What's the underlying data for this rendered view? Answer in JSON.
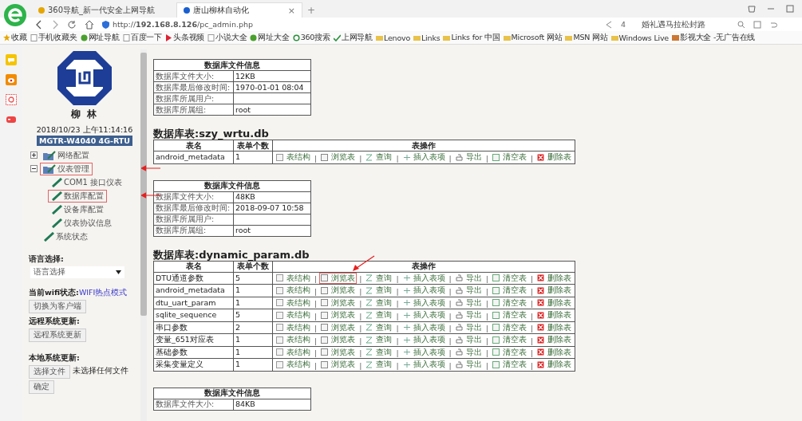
{
  "browser": {
    "tabs": [
      {
        "title": "360导航_新一代安全上网导航",
        "selected": false
      },
      {
        "title": "唐山柳林自动化",
        "selected": true
      }
    ],
    "tab_close": "×",
    "new_tab": "+",
    "url": "http://**192.168.8.126**/pc_admin.php",
    "share_count": "4",
    "search_value": "婚礼遇马拉松封路",
    "bookmarks": [
      {
        "label": "收藏",
        "kind": "star"
      },
      {
        "label": "手机收藏夹",
        "kind": "page"
      },
      {
        "label": "网址导航",
        "kind": "globe"
      },
      {
        "label": "百度一下",
        "kind": "page"
      },
      {
        "label": "头条视频",
        "kind": "play"
      },
      {
        "label": "小说大全",
        "kind": "page"
      },
      {
        "label": "网址大全",
        "kind": "globe"
      },
      {
        "label": "360搜索",
        "kind": "ring"
      },
      {
        "label": "上网导航",
        "kind": "check"
      },
      {
        "label": "Lenovo",
        "kind": "folder"
      },
      {
        "label": "Links",
        "kind": "folder"
      },
      {
        "label": "Links for 中国",
        "kind": "folder"
      },
      {
        "label": "Microsoft 网站",
        "kind": "folder"
      },
      {
        "label": "MSN 网站",
        "kind": "folder"
      },
      {
        "label": "Windows Live",
        "kind": "folder"
      },
      {
        "label": "影视大全 -无广告在线",
        "kind": "film"
      }
    ]
  },
  "sidebar": {
    "brand": "柳 林",
    "datetime": "2018/10/23 上午11:14:16",
    "device": "MGTR-W4040 4G-RTU",
    "tree": [
      {
        "label": "网络配置",
        "kind": "folder",
        "expanded": false,
        "highlighted": false
      },
      {
        "label": "仪表管理",
        "kind": "folder",
        "expanded": true,
        "highlighted": true,
        "children": [
          {
            "label": "COM1 接口仪表",
            "kind": "leaf",
            "highlighted": false
          },
          {
            "label": "数据库配置",
            "kind": "leaf",
            "highlighted": true
          },
          {
            "label": "设备库配置",
            "kind": "leaf",
            "highlighted": false
          },
          {
            "label": "仪表协议信息",
            "kind": "leaf",
            "highlighted": false
          }
        ]
      },
      {
        "label": "系统状态",
        "kind": "leaf",
        "highlighted": false
      }
    ],
    "language": {
      "label": "语言选择:",
      "value": "语言选择"
    },
    "wifi": {
      "label": "当前wifi状态:",
      "value": "WIFI热点模式",
      "button": "切换为客户端"
    },
    "remote": {
      "label": "远程系统更新:",
      "button": "远程系统更新"
    },
    "local": {
      "label": "本地系统更新:",
      "file_button": "选择文件",
      "file_status": "未选择任何文件",
      "confirm": "确定"
    }
  },
  "content": [
    {
      "kind": "info",
      "title": "数据库文件信息",
      "rows": [
        [
          "数据库文件大小:",
          "12KB"
        ],
        [
          "数据库最后修改时间:",
          "1970-01-01 08:04"
        ],
        [
          "数据库所属用户:",
          ""
        ],
        [
          "数据库所属组:",
          "root"
        ]
      ]
    },
    {
      "kind": "tables",
      "heading": "数据库表:szy_wrtu.db",
      "columns": [
        "表名",
        "表单个数",
        "表操作"
      ],
      "rows": [
        {
          "name": "android_metadata",
          "count": "1",
          "ops": [
            {
              "label": "表结构",
              "kind": "structure"
            },
            {
              "label": "|",
              "kind": "separator"
            },
            {
              "label": "浏览表",
              "kind": "browse",
              "marked": false
            },
            {
              "label": "|",
              "kind": "separator"
            },
            {
              "label": "查询",
              "kind": "query"
            },
            {
              "label": "|",
              "kind": "separator"
            },
            {
              "label": "插入表项",
              "kind": "insert"
            },
            {
              "label": "|",
              "kind": "separator"
            },
            {
              "label": "导出",
              "kind": "export"
            },
            {
              "label": "|",
              "kind": "separator"
            },
            {
              "label": "清空表",
              "kind": "empty"
            },
            {
              "label": "|",
              "kind": "separator"
            },
            {
              "label": "删除表",
              "kind": "delete"
            }
          ]
        }
      ]
    },
    {
      "kind": "info",
      "title": "数据库文件信息",
      "rows": [
        [
          "数据库文件大小:",
          "48KB"
        ],
        [
          "数据库最后修改时间:",
          "2018-09-07 10:58"
        ],
        [
          "数据库所属用户:",
          ""
        ],
        [
          "数据库所属组:",
          "root"
        ]
      ]
    },
    {
      "kind": "tables",
      "heading": "数据库表:dynamic_param.db",
      "columns": [
        "表名",
        "表单个数",
        "表操作"
      ],
      "rows": [
        {
          "name": "DTU通道参数",
          "count": "5",
          "ops": [
            {
              "label": "表结构",
              "kind": "structure"
            },
            {
              "label": "|",
              "kind": "separator"
            },
            {
              "label": "浏览表",
              "kind": "browse",
              "marked": true
            },
            {
              "label": "|",
              "kind": "separator"
            },
            {
              "label": "查询",
              "kind": "query"
            },
            {
              "label": "|",
              "kind": "separator"
            },
            {
              "label": "插入表项",
              "kind": "insert"
            },
            {
              "label": "|",
              "kind": "separator"
            },
            {
              "label": "导出",
              "kind": "export"
            },
            {
              "label": "|",
              "kind": "separator"
            },
            {
              "label": "清空表",
              "kind": "empty"
            },
            {
              "label": "|",
              "kind": "separator"
            },
            {
              "label": "删除表",
              "kind": "delete"
            }
          ]
        },
        {
          "name": "android_metadata",
          "count": "1",
          "ops": [
            {
              "label": "表结构",
              "kind": "structure"
            },
            {
              "label": "|",
              "kind": "separator"
            },
            {
              "label": "浏览表",
              "kind": "browse",
              "marked": false
            },
            {
              "label": "|",
              "kind": "separator"
            },
            {
              "label": "查询",
              "kind": "query"
            },
            {
              "label": "|",
              "kind": "separator"
            },
            {
              "label": "插入表项",
              "kind": "insert"
            },
            {
              "label": "|",
              "kind": "separator"
            },
            {
              "label": "导出",
              "kind": "export"
            },
            {
              "label": "|",
              "kind": "separator"
            },
            {
              "label": "清空表",
              "kind": "empty"
            },
            {
              "label": "|",
              "kind": "separator"
            },
            {
              "label": "删除表",
              "kind": "delete"
            }
          ]
        },
        {
          "name": "dtu_uart_param",
          "count": "1",
          "ops": [
            {
              "label": "表结构",
              "kind": "structure"
            },
            {
              "label": "|",
              "kind": "separator"
            },
            {
              "label": "浏览表",
              "kind": "browse",
              "marked": false
            },
            {
              "label": "|",
              "kind": "separator"
            },
            {
              "label": "查询",
              "kind": "query"
            },
            {
              "label": "|",
              "kind": "separator"
            },
            {
              "label": "插入表项",
              "kind": "insert"
            },
            {
              "label": "|",
              "kind": "separator"
            },
            {
              "label": "导出",
              "kind": "export"
            },
            {
              "label": "|",
              "kind": "separator"
            },
            {
              "label": "清空表",
              "kind": "empty"
            },
            {
              "label": "|",
              "kind": "separator"
            },
            {
              "label": "删除表",
              "kind": "delete"
            }
          ]
        },
        {
          "name": "sqlite_sequence",
          "count": "5",
          "ops": [
            {
              "label": "表结构",
              "kind": "structure"
            },
            {
              "label": "|",
              "kind": "separator"
            },
            {
              "label": "浏览表",
              "kind": "browse",
              "marked": false
            },
            {
              "label": "|",
              "kind": "separator"
            },
            {
              "label": "查询",
              "kind": "query"
            },
            {
              "label": "|",
              "kind": "separator"
            },
            {
              "label": "插入表项",
              "kind": "insert"
            },
            {
              "label": "|",
              "kind": "separator"
            },
            {
              "label": "导出",
              "kind": "export"
            },
            {
              "label": "|",
              "kind": "separator"
            },
            {
              "label": "清空表",
              "kind": "empty"
            },
            {
              "label": "|",
              "kind": "separator"
            },
            {
              "label": "删除表",
              "kind": "delete"
            }
          ]
        },
        {
          "name": "串口参数",
          "count": "2",
          "ops": [
            {
              "label": "表结构",
              "kind": "structure"
            },
            {
              "label": "|",
              "kind": "separator"
            },
            {
              "label": "浏览表",
              "kind": "browse",
              "marked": false
            },
            {
              "label": "|",
              "kind": "separator"
            },
            {
              "label": "查询",
              "kind": "query"
            },
            {
              "label": "|",
              "kind": "separator"
            },
            {
              "label": "插入表项",
              "kind": "insert"
            },
            {
              "label": "|",
              "kind": "separator"
            },
            {
              "label": "导出",
              "kind": "export"
            },
            {
              "label": "|",
              "kind": "separator"
            },
            {
              "label": "清空表",
              "kind": "empty"
            },
            {
              "label": "|",
              "kind": "separator"
            },
            {
              "label": "删除表",
              "kind": "delete"
            }
          ]
        },
        {
          "name": "变量_651对应表",
          "count": "1",
          "ops": [
            {
              "label": "表结构",
              "kind": "structure"
            },
            {
              "label": "|",
              "kind": "separator"
            },
            {
              "label": "浏览表",
              "kind": "browse",
              "marked": false
            },
            {
              "label": "|",
              "kind": "separator"
            },
            {
              "label": "查询",
              "kind": "query"
            },
            {
              "label": "|",
              "kind": "separator"
            },
            {
              "label": "插入表项",
              "kind": "insert"
            },
            {
              "label": "|",
              "kind": "separator"
            },
            {
              "label": "导出",
              "kind": "export"
            },
            {
              "label": "|",
              "kind": "separator"
            },
            {
              "label": "清空表",
              "kind": "empty"
            },
            {
              "label": "|",
              "kind": "separator"
            },
            {
              "label": "删除表",
              "kind": "delete"
            }
          ]
        },
        {
          "name": "基础参数",
          "count": "1",
          "ops": [
            {
              "label": "表结构",
              "kind": "structure"
            },
            {
              "label": "|",
              "kind": "separator"
            },
            {
              "label": "浏览表",
              "kind": "browse",
              "marked": false
            },
            {
              "label": "|",
              "kind": "separator"
            },
            {
              "label": "查询",
              "kind": "query"
            },
            {
              "label": "|",
              "kind": "separator"
            },
            {
              "label": "插入表项",
              "kind": "insert"
            },
            {
              "label": "|",
              "kind": "separator"
            },
            {
              "label": "导出",
              "kind": "export"
            },
            {
              "label": "|",
              "kind": "separator"
            },
            {
              "label": "清空表",
              "kind": "empty"
            },
            {
              "label": "|",
              "kind": "separator"
            },
            {
              "label": "删除表",
              "kind": "delete"
            }
          ]
        },
        {
          "name": "采集变量定义",
          "count": "1",
          "ops": [
            {
              "label": "表结构",
              "kind": "structure"
            },
            {
              "label": "|",
              "kind": "separator"
            },
            {
              "label": "浏览表",
              "kind": "browse",
              "marked": false
            },
            {
              "label": "|",
              "kind": "separator"
            },
            {
              "label": "查询",
              "kind": "query"
            },
            {
              "label": "|",
              "kind": "separator"
            },
            {
              "label": "插入表项",
              "kind": "insert"
            },
            {
              "label": "|",
              "kind": "separator"
            },
            {
              "label": "导出",
              "kind": "export"
            },
            {
              "label": "|",
              "kind": "separator"
            },
            {
              "label": "清空表",
              "kind": "empty"
            },
            {
              "label": "|",
              "kind": "separator"
            },
            {
              "label": "删除表",
              "kind": "delete"
            }
          ]
        }
      ]
    },
    {
      "kind": "info",
      "title": "数据库文件信息",
      "rows": [
        [
          "数据库文件大小:",
          "84KB"
        ]
      ]
    }
  ]
}
